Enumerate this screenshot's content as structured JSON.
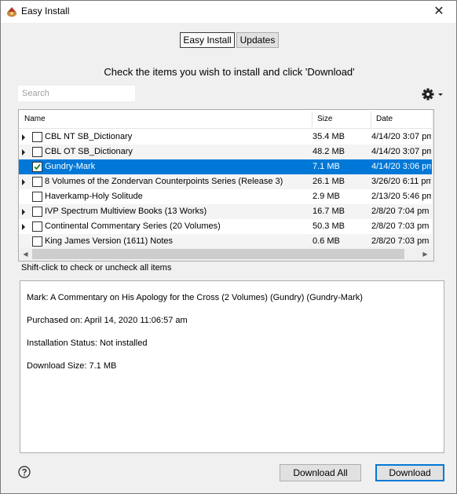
{
  "window": {
    "title": "Easy Install",
    "close_glyph": "✕",
    "app_icon": "logos-app-icon"
  },
  "tabs": [
    {
      "label": "Easy Install",
      "active": true
    },
    {
      "label": "Updates",
      "active": false
    }
  ],
  "instruction": "Check the items you wish to install and click 'Download'",
  "search": {
    "placeholder": "Search",
    "value": ""
  },
  "settings": {
    "icon": "gear-icon"
  },
  "list": {
    "columns": [
      "Name",
      "Size",
      "Date"
    ],
    "rows": [
      {
        "name": "CBL NT SB_Dictionary",
        "size": "35.4 MB",
        "date": "4/14/20 3:07 pm",
        "expandable": true,
        "checked": false,
        "selected": false
      },
      {
        "name": "CBL OT SB_Dictionary",
        "size": "48.2 MB",
        "date": "4/14/20 3:07 pm",
        "expandable": true,
        "checked": false,
        "selected": false
      },
      {
        "name": "Gundry-Mark",
        "size": "7.1 MB",
        "date": "4/14/20 3:06 pm",
        "expandable": false,
        "checked": true,
        "selected": true
      },
      {
        "name": "8 Volumes of the Zondervan Counterpoints Series (Release 3)",
        "size": "26.1 MB",
        "date": "3/26/20 6:11 pm",
        "expandable": true,
        "checked": false,
        "selected": false
      },
      {
        "name": "Haverkamp-Holy Solitude",
        "size": "2.9 MB",
        "date": "2/13/20 5:46 pm",
        "expandable": false,
        "checked": false,
        "selected": false
      },
      {
        "name": "IVP Spectrum Multiview Books (13 Works)",
        "size": "16.7 MB",
        "date": "2/8/20 7:04 pm",
        "expandable": true,
        "checked": false,
        "selected": false
      },
      {
        "name": "Continental Commentary Series (20 Volumes)",
        "size": "50.3 MB",
        "date": "2/8/20 7:03 pm",
        "expandable": true,
        "checked": false,
        "selected": false
      },
      {
        "name": "King James Version (1611) Notes",
        "size": "0.6 MB",
        "date": "2/8/20 7:03 pm",
        "expandable": false,
        "checked": false,
        "selected": false
      }
    ]
  },
  "hint": "Shift-click to check or uncheck all items",
  "details": {
    "title": "Mark: A Commentary on His Apology for the Cross (2 Volumes) (Gundry) (Gundry-Mark)",
    "purchased": "Purchased on: April 14, 2020 11:06:57 am",
    "status": "Installation Status: Not installed",
    "download_size": "Download Size: 7.1 MB"
  },
  "buttons": {
    "download_all": "Download All",
    "download": "Download"
  },
  "colors": {
    "selection": "#0078d7",
    "default_button_border": "#0078d7"
  }
}
